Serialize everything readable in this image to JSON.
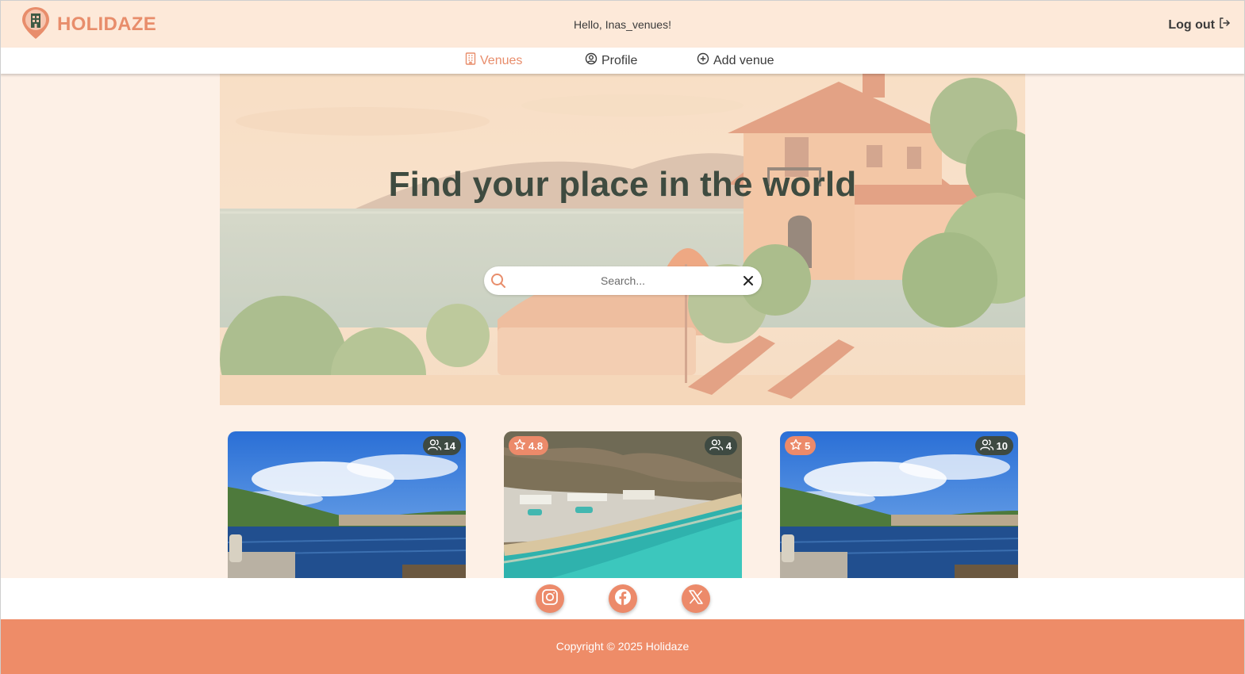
{
  "brand": {
    "name": "HOLIDAZE",
    "icon": "map-pin-building-icon",
    "color": "#e88d6b"
  },
  "header": {
    "greeting": "Hello, Inas_venues!",
    "logout_label": "Log out",
    "logout_icon": "logout-arrow-icon"
  },
  "nav": {
    "items": [
      {
        "label": "Venues",
        "icon": "building-icon",
        "active": true
      },
      {
        "label": "Profile",
        "icon": "user-circle-icon",
        "active": false
      },
      {
        "label": "Add venue",
        "icon": "plus-circle-icon",
        "active": false
      }
    ]
  },
  "hero": {
    "title": "Find your place in the world",
    "search": {
      "placeholder": "Search...",
      "value": ""
    }
  },
  "venues": [
    {
      "guests": "14",
      "rating": null,
      "image": "harbor-blue-sky"
    },
    {
      "guests": "4",
      "rating": "4.8",
      "image": "beach-resort-aerial"
    },
    {
      "guests": "10",
      "rating": "5",
      "image": "harbor-blue-sky"
    }
  ],
  "social": [
    {
      "icon": "instagram-icon"
    },
    {
      "icon": "facebook-icon"
    },
    {
      "icon": "x-icon"
    }
  ],
  "footer": {
    "copyright": "Copyright © 2025 Holidaze"
  },
  "colors": {
    "accent": "#ee8c68",
    "page_bg": "#fdf0e6",
    "header_bg": "#fde9d9",
    "badge_dark": "#3e4a42"
  }
}
